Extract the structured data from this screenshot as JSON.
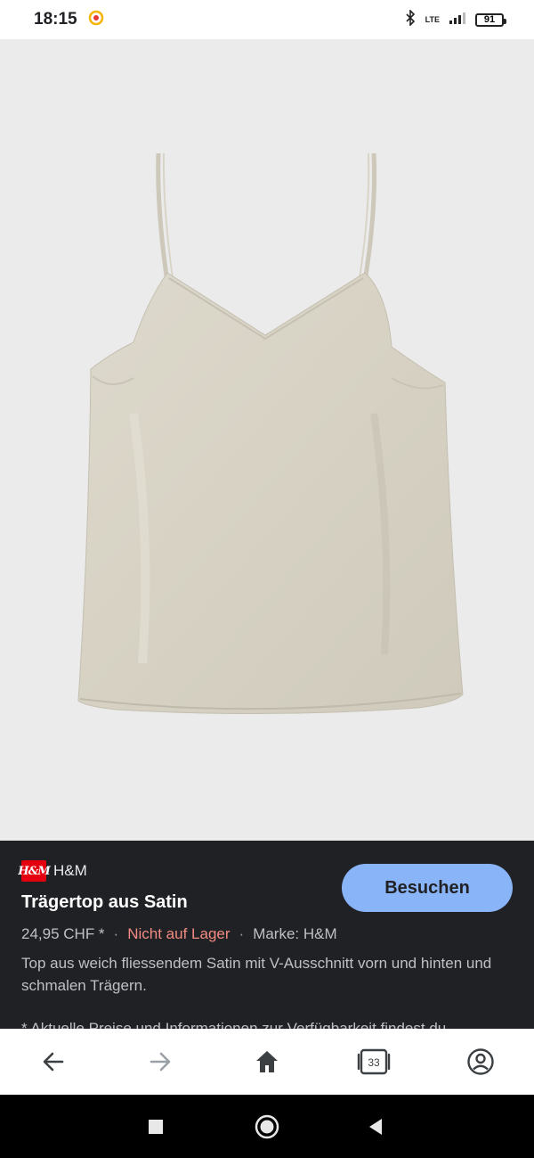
{
  "status_bar": {
    "time": "18:15",
    "network": "LTE",
    "battery": "91"
  },
  "product_image": {
    "alt": "Trägertop aus Satin",
    "colors": {
      "background": "#ebebeb",
      "garment": "#d9d5c8",
      "garment_shadow": "#c7c2b3"
    }
  },
  "info_panel": {
    "merchant_logo_text": "H&M",
    "merchant_name": "H&M",
    "title": "Trägertop aus Satin",
    "visit_button": "Besuchen",
    "price": "24,95 CHF *",
    "stock_status": "Nicht auf Lager",
    "brand": "Marke: H&M",
    "description": "Top aus weich fliessendem Satin mit V-Ausschnitt vorn und hinten und schmalen Trägern.",
    "disclaimer": "* Aktuelle Preise und Informationen zur Verfügbarkeit findest du",
    "colors": {
      "panel": "#202124",
      "button": "#8ab4f8",
      "stock": "#f28b82"
    }
  },
  "toolbar": {
    "tab_count": "33"
  }
}
